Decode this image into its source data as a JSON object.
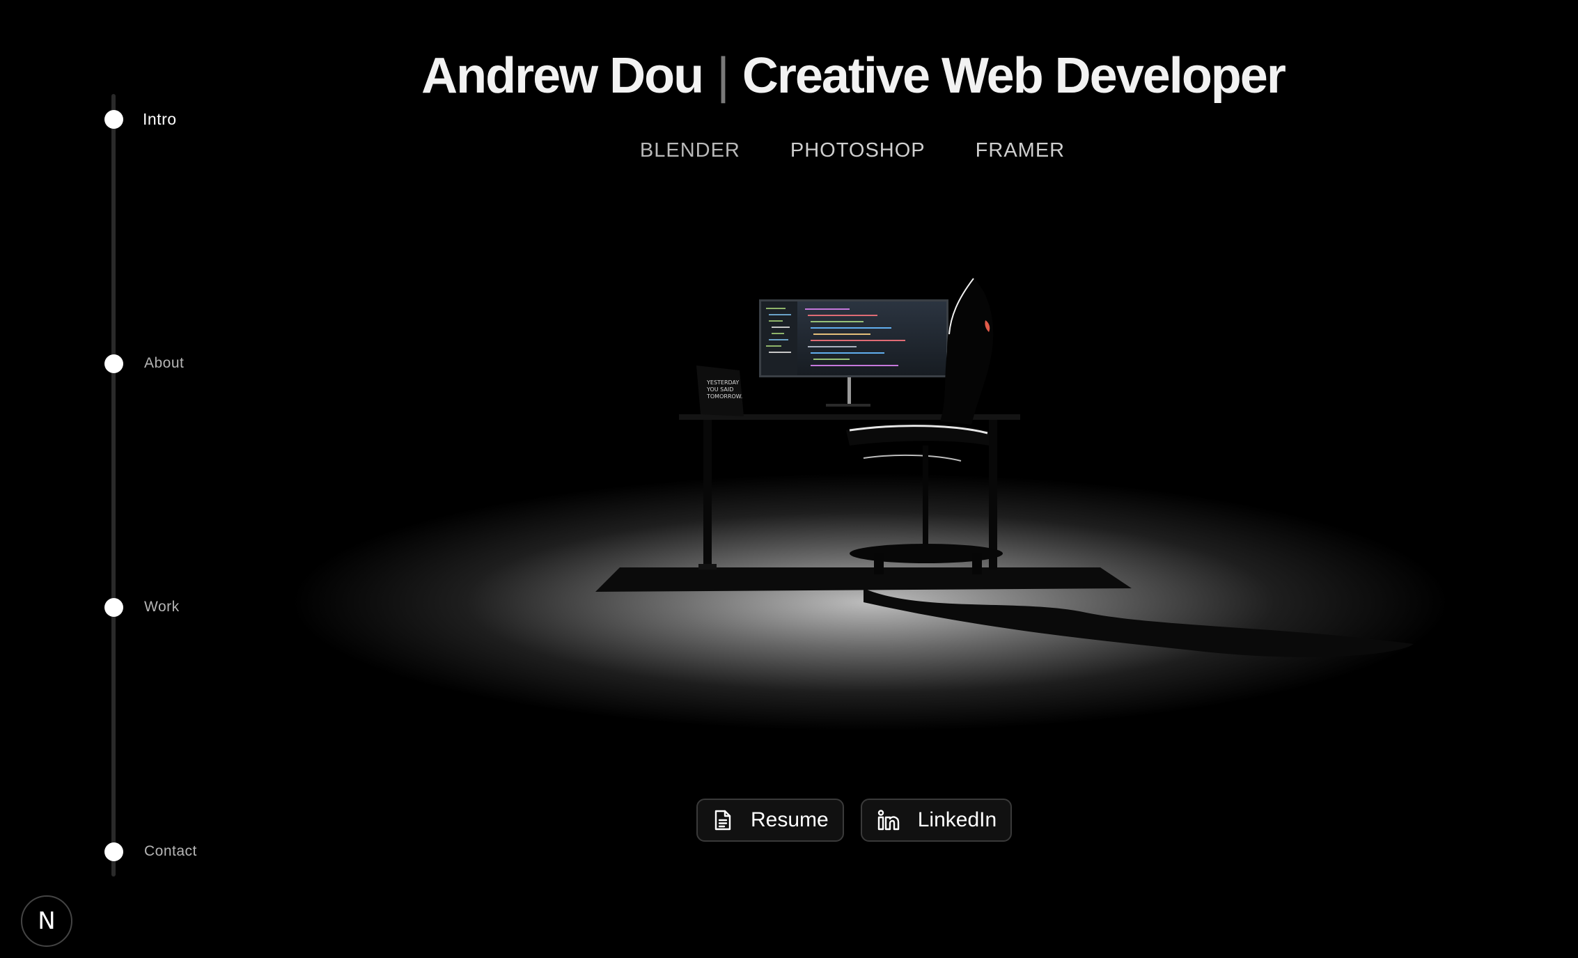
{
  "header": {
    "name": "Andrew Dou",
    "separator": "|",
    "role": "Creative Web Developer",
    "skills": [
      "BLENDER",
      "PHOTOSHOP",
      "FRAMER"
    ]
  },
  "nav": {
    "items": [
      {
        "label": "Intro",
        "active": true
      },
      {
        "label": "About",
        "active": false
      },
      {
        "label": "Work",
        "active": false
      },
      {
        "label": "Contact",
        "active": false
      }
    ]
  },
  "scene": {
    "poster_text": [
      "YESTERDAY",
      "YOU SAID",
      "TOMORROW."
    ],
    "icons": [
      "monitor",
      "office-chair",
      "desk",
      "poster"
    ]
  },
  "actions": {
    "resume_label": "Resume",
    "linkedin_label": "LinkedIn"
  },
  "logo": {
    "letter": "N"
  },
  "colors": {
    "background": "#000000",
    "text": "#ffffff",
    "muted": "#b5b5b5",
    "border": "#3a3a3a"
  }
}
